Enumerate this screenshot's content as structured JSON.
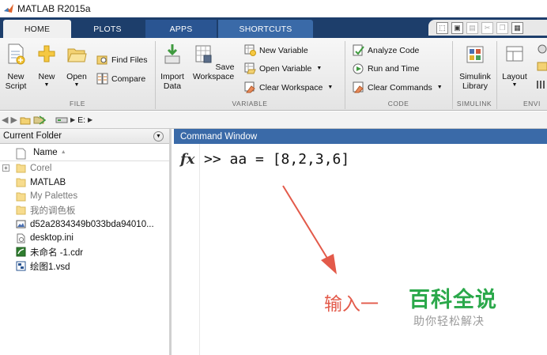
{
  "window": {
    "title": "MATLAB R2015a"
  },
  "tabs": [
    {
      "label": "HOME"
    },
    {
      "label": "PLOTS"
    },
    {
      "label": "APPS"
    },
    {
      "label": "SHORTCUTS"
    }
  ],
  "ribbon": {
    "file": {
      "label": "FILE",
      "new_script": [
        "New",
        "Script"
      ],
      "new": [
        "New",
        ""
      ],
      "open": [
        "Open",
        ""
      ],
      "find_files": "Find Files",
      "compare": "Compare"
    },
    "variable": {
      "label": "VARIABLE",
      "import_data": [
        "Import",
        "Data"
      ],
      "save_workspace": [
        "Save",
        "Workspace"
      ],
      "new_variable": "New Variable",
      "open_variable": "Open Variable",
      "clear_workspace": "Clear Workspace"
    },
    "code": {
      "label": "CODE",
      "analyze_code": "Analyze Code",
      "run_and_time": "Run and Time",
      "clear_commands": "Clear Commands"
    },
    "simulink": {
      "label": "SIMULINK",
      "simulink_library": [
        "Simulink",
        "Library"
      ]
    },
    "environment": {
      "label": "ENVI",
      "layout": "Layout"
    }
  },
  "address": {
    "drive": "E:"
  },
  "current_folder": {
    "title": "Current Folder",
    "column_name": "Name",
    "items": [
      {
        "name": "Corel",
        "kind": "folder",
        "muted": true,
        "expandable": true
      },
      {
        "name": "MATLAB",
        "kind": "folder",
        "muted": false,
        "expandable": false
      },
      {
        "name": "My Palettes",
        "kind": "folder",
        "muted": true,
        "expandable": false
      },
      {
        "name": "我的调色板",
        "kind": "folder",
        "muted": true,
        "expandable": false
      },
      {
        "name": "d52a2834349b033bda94010...",
        "kind": "image-file",
        "muted": false,
        "expandable": false
      },
      {
        "name": "desktop.ini",
        "kind": "ini-file",
        "muted": false,
        "expandable": false
      },
      {
        "name": "未命名 -1.cdr",
        "kind": "cdr-file",
        "muted": false,
        "expandable": false
      },
      {
        "name": "绘图1.vsd",
        "kind": "vsd-file",
        "muted": false,
        "expandable": false
      }
    ]
  },
  "command_window": {
    "title": "Command Window",
    "fx_label": "fx",
    "command_line": ">> aa = [8,2,3,6]"
  },
  "annotation": {
    "text": "输入一"
  },
  "watermark": {
    "main": "百科全说",
    "sub": "助你轻松解决"
  },
  "colors": {
    "tab_bar": "#1d3e6b",
    "command_window_header": "#3a6aa8",
    "annotation_red": "#e35a4a",
    "watermark_green": "#2aa84a"
  }
}
